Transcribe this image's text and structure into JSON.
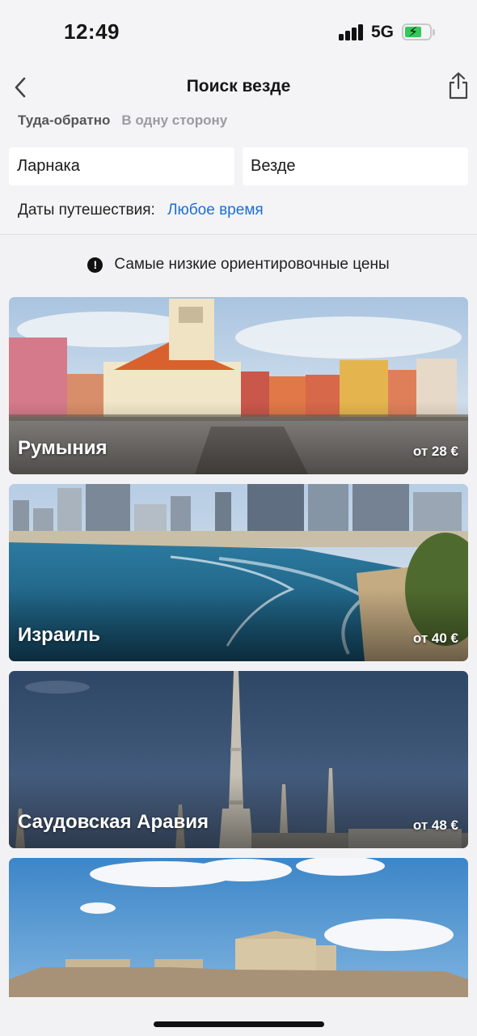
{
  "status_bar": {
    "time": "12:49",
    "network": "5G",
    "battery_state": "charging",
    "battery_color": "#35c759"
  },
  "header": {
    "title": "Поиск везде",
    "back_icon": "chevron-left-icon",
    "share_icon": "share-icon",
    "trip_types": [
      {
        "label": "Туда-обратно",
        "selected": true
      },
      {
        "label": "В одну сторону",
        "selected": false
      }
    ],
    "from_value": "Ларнака",
    "to_value": "Везде",
    "dates_label": "Даты путешествия:",
    "dates_value": "Любое время"
  },
  "notice": {
    "icon": "exclamation-circle-icon",
    "text": "Самые низкие ориентировочные цены"
  },
  "destinations": [
    {
      "country": "Румыния",
      "price": "от 28 €",
      "image": "town-square-photo"
    },
    {
      "country": "Израиль",
      "price": "от 40 €",
      "image": "seaside-city-photo"
    },
    {
      "country": "Саудовская Аравия",
      "price": "от 48 €",
      "image": "minaret-photo"
    },
    {
      "country": "",
      "price": "",
      "image": "acropolis-photo"
    }
  ],
  "colors": {
    "accent_link": "#1a6fd6",
    "background": "#f2f2f4"
  }
}
